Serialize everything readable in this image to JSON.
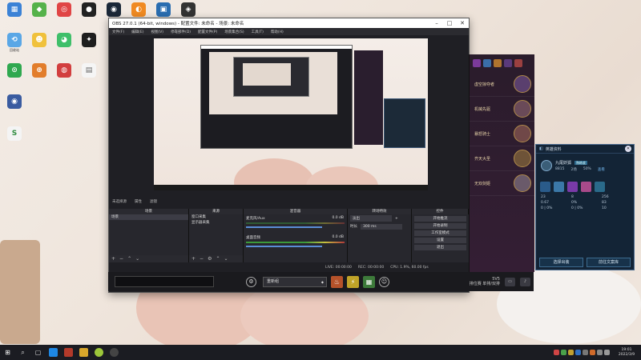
{
  "desktop_icons": [
    {
      "name": "this-pc",
      "label": "",
      "color": "#3b82d6",
      "glyph": "▦"
    },
    {
      "name": "app2",
      "label": "",
      "color": "#55b24a",
      "glyph": "◆"
    },
    {
      "name": "app3",
      "label": "",
      "color": "#e04545",
      "glyph": "◎"
    },
    {
      "name": "app4",
      "label": "",
      "color": "#222222",
      "glyph": "●"
    },
    {
      "name": "steam",
      "label": "",
      "color": "#1b2838",
      "glyph": "◉"
    },
    {
      "name": "app6",
      "label": "",
      "color": "#f08a22",
      "glyph": "◐"
    },
    {
      "name": "app7",
      "label": "",
      "color": "#2a6db0",
      "glyph": "▣"
    },
    {
      "name": "app8",
      "label": "",
      "color": "#333333",
      "glyph": "◈"
    }
  ],
  "desktop_icons_row2": [
    {
      "name": "recycle",
      "label": "回收站",
      "color": "#5aa7e6",
      "glyph": "⟲"
    },
    {
      "name": "app-yellow",
      "label": "",
      "color": "#f0c13c",
      "glyph": "☻"
    },
    {
      "name": "app-green",
      "label": "",
      "color": "#3fbf6a",
      "glyph": "◕"
    },
    {
      "name": "qq",
      "label": "",
      "color": "#1e1e1e",
      "glyph": "✦"
    }
  ],
  "desktop_icons_row3": [
    {
      "name": "app-green2",
      "label": "",
      "color": "#2fa84f",
      "glyph": "⊙"
    },
    {
      "name": "app-orange",
      "label": "",
      "color": "#e27d2b",
      "glyph": "⊕"
    },
    {
      "name": "app-red",
      "label": "",
      "color": "#d23e3e",
      "glyph": "◍"
    },
    {
      "name": "doc",
      "label": "",
      "color": "#f5f5f5",
      "glyph": "▤"
    }
  ],
  "obs": {
    "title": "OBS 27.0.1 (64-bit, windows) - 配置文件: 未命名 - 场景: 未命名",
    "menu": [
      "文件(F)",
      "编辑(E)",
      "视图(V)",
      "停靠部件(D)",
      "配置文件(P)",
      "场景集合(S)",
      "工具(T)",
      "帮助(H)"
    ],
    "status_items": [
      "未选择源",
      "属性",
      "滤镜"
    ],
    "docks": {
      "scenes": "场景",
      "sources": "来源",
      "mixer": "混音器",
      "transitions": "转场特效",
      "controls": "控件"
    },
    "scene_items": [
      "场景"
    ],
    "source_items": [
      "窗口采集",
      "显示器采集"
    ],
    "mixer": [
      {
        "name": "麦克风/Aux",
        "db": "0.0 dB"
      },
      {
        "name": "桌面音频",
        "db": "0.0 dB"
      }
    ],
    "transitions": {
      "type": "淡出",
      "duration_label": "时长",
      "duration": "300 ms"
    },
    "controls": [
      "开始推流",
      "开始录制",
      "工作室模式",
      "设置",
      "退出"
    ],
    "footer": [
      "LIVE: 00:00:00",
      "REC: 00:00:00",
      "CPU: 1.9%, 60.00 fps"
    ]
  },
  "bottom_bar": {
    "select": "重新组",
    "svs_top": "5V5",
    "svs_bottom": "排位赛 单排/双排"
  },
  "lol": {
    "champions": [
      {
        "name": "虚空掠夺者",
        "color": "#5a3f6e"
      },
      {
        "name": "机械先驱",
        "color": "#6a4a58"
      },
      {
        "name": "暴怒骑士",
        "color": "#704848"
      },
      {
        "name": "齐天大圣",
        "color": "#6e5338"
      },
      {
        "name": "无双剑姬",
        "color": "#6a5a6a"
      }
    ]
  },
  "hero_card": {
    "title": "英雄资料",
    "name": "九尾妖狐",
    "badge": "熟练度",
    "stats": [
      "8815",
      "2场",
      "50%"
    ],
    "action": "查看",
    "grid": [
      "23",
      "8",
      "256",
      "0.67",
      "0%",
      "83",
      "0 | 0%",
      "0 | 0%",
      "10"
    ],
    "buttons": [
      "选择出装",
      "前往文案库"
    ]
  },
  "taskbar": {
    "time": "19:01",
    "date": "2022/3/9"
  }
}
